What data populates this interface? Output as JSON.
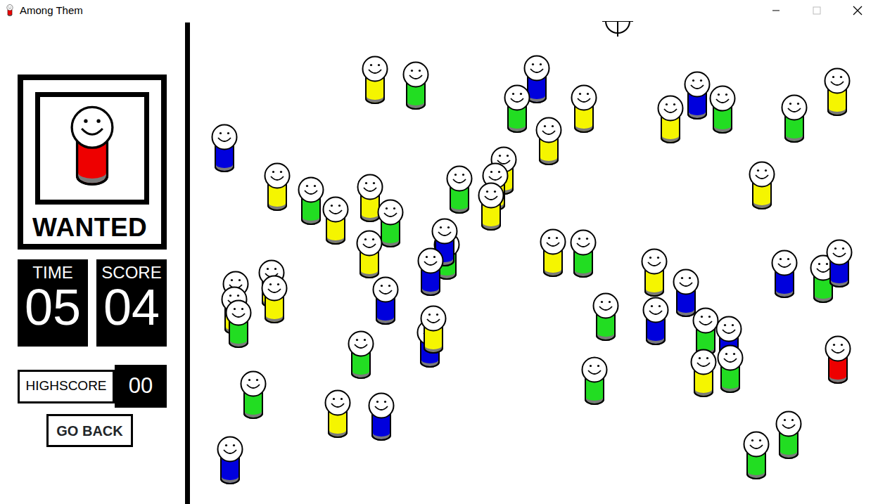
{
  "window": {
    "title": "Among Them"
  },
  "wanted": {
    "label": "WANTED",
    "color": "#ee0000"
  },
  "time": {
    "label": "TIME",
    "value": "05"
  },
  "score": {
    "label": "SCORE",
    "value": "04"
  },
  "highscore": {
    "label": "HIGHSCORE",
    "value": "00"
  },
  "buttons": [
    "GO BACK"
  ],
  "crowd": [
    {
      "color": "#f5f500"
    },
    {
      "color": "#22dd22"
    },
    {
      "color": "#0000dd"
    },
    {
      "color": "#22dd22"
    },
    {
      "color": "#f5f500"
    },
    {
      "color": "#0000dd"
    },
    {
      "color": "#f5f500"
    },
    {
      "color": "#22dd22"
    },
    {
      "color": "#22dd22"
    },
    {
      "color": "#f5f500"
    },
    {
      "color": "#0000dd"
    },
    {
      "color": "#f5f500"
    },
    {
      "color": "#f5f500"
    },
    {
      "color": "#22dd22"
    },
    {
      "color": "#f5f500"
    },
    {
      "color": "#f5f500"
    },
    {
      "color": "#22dd22"
    },
    {
      "color": "#f5f500"
    },
    {
      "color": "#f5f500"
    },
    {
      "color": "#22dd22"
    },
    {
      "color": "#f5f500"
    },
    {
      "color": "#f5f500"
    },
    {
      "color": "#22dd22"
    },
    {
      "color": "#0000dd"
    },
    {
      "color": "#0000dd"
    },
    {
      "color": "#f5f500"
    },
    {
      "color": "#f5f500"
    },
    {
      "color": "#22dd22"
    },
    {
      "color": "#f5f500"
    },
    {
      "color": "#0000dd"
    },
    {
      "color": "#0000dd"
    },
    {
      "color": "#22dd22"
    },
    {
      "color": "#0000dd"
    },
    {
      "color": "#f5f500"
    },
    {
      "color": "#f5f500"
    },
    {
      "color": "#22dd22"
    },
    {
      "color": "#f5f500"
    },
    {
      "color": "#f5f500"
    },
    {
      "color": "#0000dd"
    },
    {
      "color": "#22dd22"
    },
    {
      "color": "#0000dd"
    },
    {
      "color": "#0000dd"
    },
    {
      "color": "#22dd22"
    },
    {
      "color": "#f5f500"
    },
    {
      "color": "#22dd22"
    },
    {
      "color": "#0000dd"
    },
    {
      "color": "#f5f500"
    },
    {
      "color": "#22dd22"
    },
    {
      "color": "#22dd22"
    },
    {
      "color": "#f5f500"
    },
    {
      "color": "#0000dd"
    },
    {
      "color": "#22dd22"
    },
    {
      "color": "#ee0000"
    },
    {
      "color": "#22dd22"
    },
    {
      "color": "#22dd22"
    },
    {
      "color": "#0000dd"
    }
  ]
}
